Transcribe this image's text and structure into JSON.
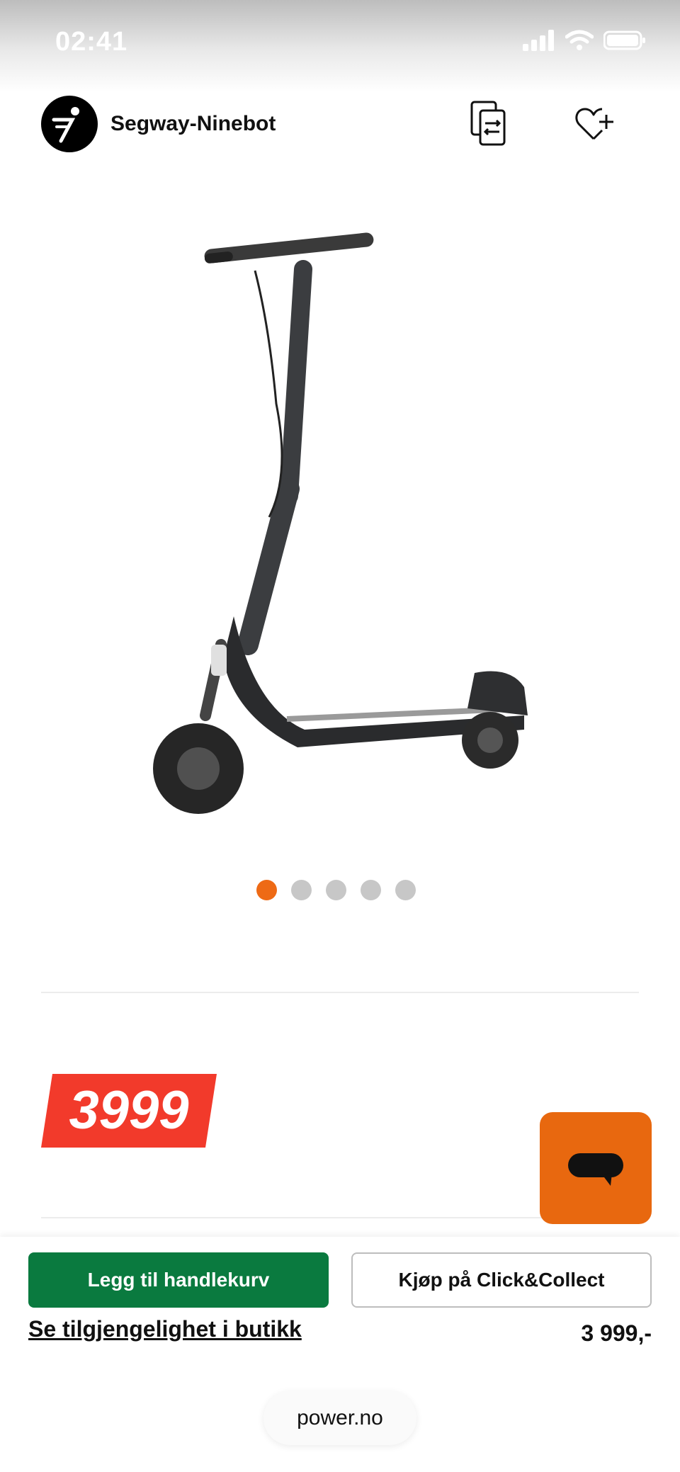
{
  "status_bar": {
    "time": "02:41"
  },
  "header": {
    "brand_name": "Segway-Ninebot"
  },
  "gallery": {
    "dot_count": 5,
    "active_index": 0
  },
  "price": {
    "badge": "3999",
    "formatted": "3 999,-"
  },
  "actions": {
    "add_to_cart": "Legg til handlekurv",
    "click_collect": "Kjøp på Click&Collect",
    "availability_link": "Se tilgjengelighet i butikk"
  },
  "browser": {
    "url": "power.no"
  },
  "colors": {
    "accent": "#ee6a15",
    "price_red": "#f23a2b",
    "cart_green": "#0a7a3f"
  },
  "icons": [
    "signal-icon",
    "wifi-icon",
    "battery-icon",
    "brand-logo-icon",
    "compare-icon",
    "wishlist-add-icon",
    "chat-icon"
  ]
}
